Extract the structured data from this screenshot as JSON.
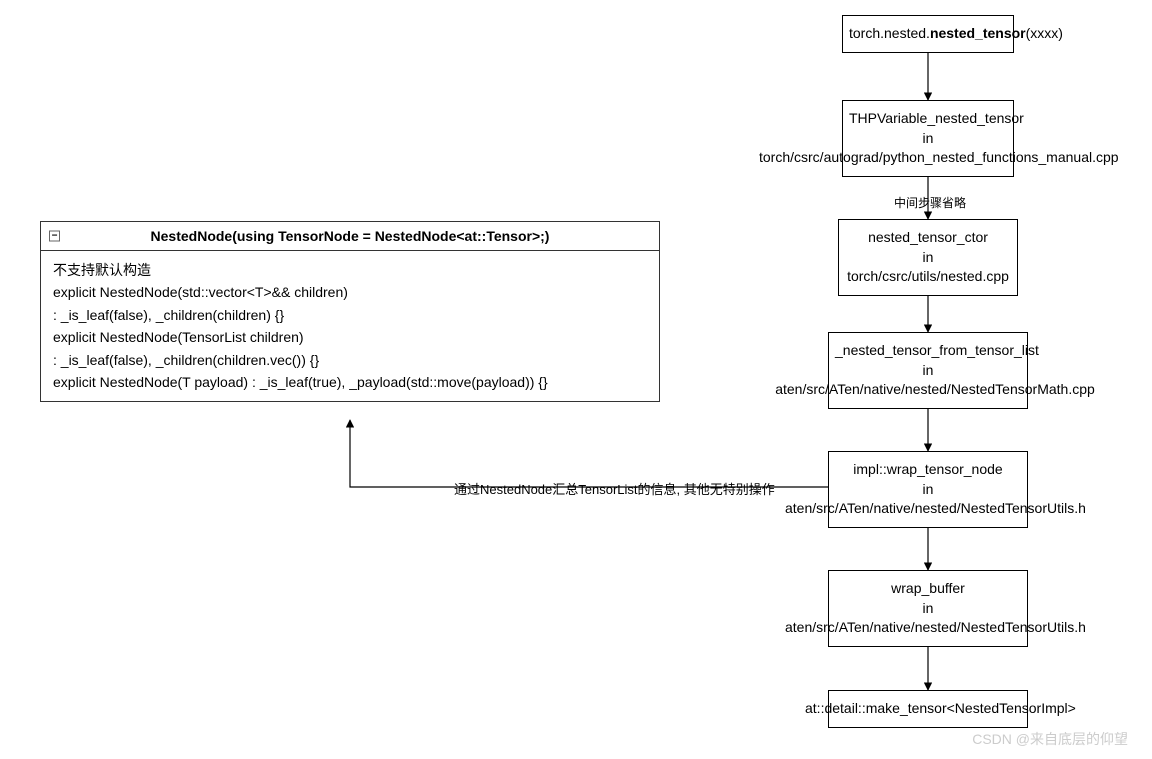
{
  "flow": {
    "n1": {
      "prefix": "torch.nested.",
      "bold": "nested_tensor",
      "suffix": "(xxxx)"
    },
    "n2": {
      "l1": "THPVariable_nested_tensor",
      "l2": "in",
      "l3": "torch/csrc/autograd/python_nested_functions_manual.cpp"
    },
    "edge12_label": "中间步骤省略",
    "n3": {
      "l1": "nested_tensor_ctor",
      "l2": "in",
      "l3": "torch/csrc/utils/nested.cpp"
    },
    "n4": {
      "l1": "_nested_tensor_from_tensor_list",
      "l2": "in",
      "l3": "aten/src/ATen/native/nested/NestedTensorMath.cpp"
    },
    "n5": {
      "l1": "impl::wrap_tensor_node",
      "l2": "in",
      "l3": "aten/src/ATen/native/nested/NestedTensorUtils.h"
    },
    "n6": {
      "l1": "wrap_buffer",
      "l2": "in",
      "l3": "aten/src/ATen/native/nested/NestedTensorUtils.h"
    },
    "n7": {
      "l1": "at::detail::make_tensor<NestedTensorImpl>"
    },
    "edge5class_label": "通过NestedNode汇总TensorList的信息, 其他无特别操作"
  },
  "classbox": {
    "title": "NestedNode(using TensorNode = NestedNode<at::Tensor>;)",
    "collapse": "−",
    "body": [
      "不支持默认构造",
      "explicit NestedNode(std::vector<T>&& children)",
      ": _is_leaf(false), _children(children) {}",
      "explicit NestedNode(TensorList children)",
      ": _is_leaf(false), _children(children.vec()) {}",
      "explicit NestedNode(T payload) : _is_leaf(true), _payload(std::move(payload)) {}"
    ]
  },
  "watermark": "CSDN @来自底层的仰望"
}
